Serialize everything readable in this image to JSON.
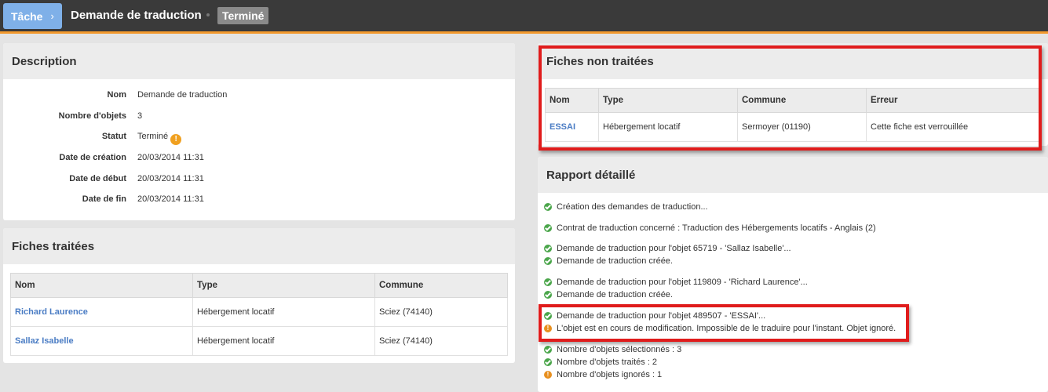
{
  "topbar": {
    "task_label": "Tâche",
    "title": "Demande de traduction",
    "status": "Terminé"
  },
  "description": {
    "heading": "Description",
    "rows": [
      {
        "label": "Nom",
        "value": "Demande de traduction"
      },
      {
        "label": "Nombre d'objets",
        "value": "3"
      },
      {
        "label": "Statut",
        "value": "Terminé"
      },
      {
        "label": "Date de création",
        "value": "20/03/2014 11:31"
      },
      {
        "label": "Date de début",
        "value": "20/03/2014 11:31"
      },
      {
        "label": "Date de fin",
        "value": "20/03/2014 11:31"
      }
    ]
  },
  "processed": {
    "heading": "Fiches traitées",
    "columns": [
      "Nom",
      "Type",
      "Commune"
    ],
    "rows": [
      [
        "Richard Laurence",
        "Hébergement locatif",
        "Sciez (74140)"
      ],
      [
        "Sallaz Isabelle",
        "Hébergement locatif",
        "Sciez (74140)"
      ]
    ]
  },
  "unprocessed": {
    "heading": "Fiches non traitées",
    "columns": [
      "Nom",
      "Type",
      "Commune",
      "Erreur"
    ],
    "rows": [
      [
        "ESSAI",
        "Hébergement locatif",
        "Sermoyer (01190)",
        "Cette fiche est verrouillée"
      ]
    ]
  },
  "report": {
    "heading": "Rapport détaillé",
    "lines": [
      {
        "icon": "check-icon",
        "text": "Création des demandes de traduction..."
      },
      {
        "icon": "check-icon",
        "text": "Contrat de traduction concerné : Traduction des Hébergements locatifs - Anglais (2)"
      },
      {
        "icon": "check-icon",
        "text": "Demande de traduction pour l'objet 65719 - 'Sallaz Isabelle'..."
      },
      {
        "icon": "check-icon",
        "text": "Demande de traduction créée."
      },
      {
        "icon": "check-icon",
        "text": "Demande de traduction pour l'objet 119809 - 'Richard Laurence'..."
      },
      {
        "icon": "check-icon",
        "text": "Demande de traduction créée."
      },
      {
        "icon": "check-icon",
        "text": "Demande de traduction pour l'objet 489507 - 'ESSAI'..."
      },
      {
        "icon": "error-icon",
        "text": "L'objet est en cours de modification. Impossible de le traduire pour l'instant. Objet ignoré."
      },
      {
        "icon": "check-icon",
        "text": "Nombre d'objets sélectionnés : 3"
      },
      {
        "icon": "check-icon",
        "text": "Nombre d'objets traités : 2"
      },
      {
        "icon": "error-icon",
        "text": "Nombre d'objets ignorés : 1"
      }
    ]
  },
  "colors": {
    "accent": "#f39a2e",
    "link": "#4a7cc4",
    "highlight": "#e01c1c"
  }
}
